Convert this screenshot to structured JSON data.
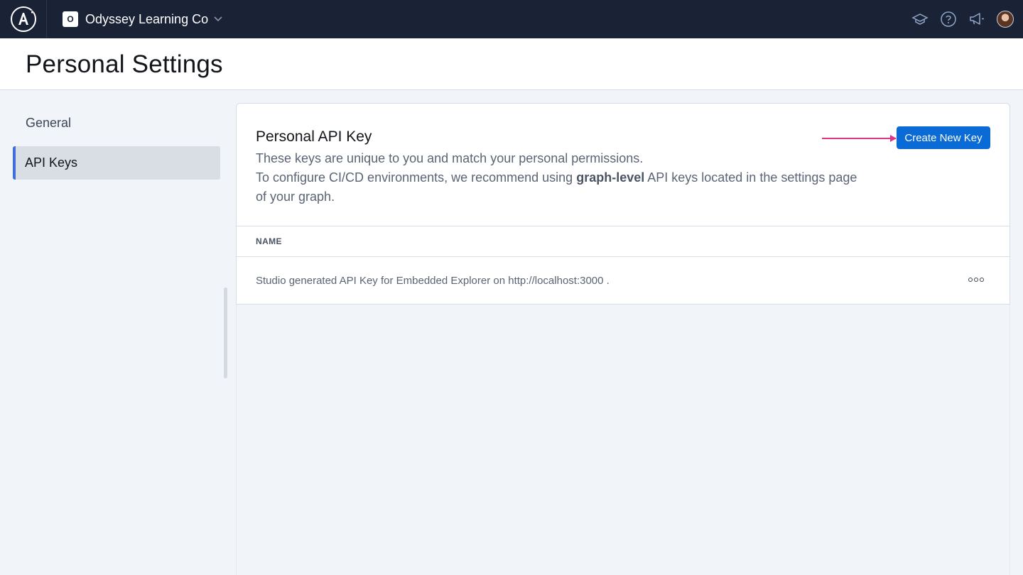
{
  "topbar": {
    "org_initial": "O",
    "org_name": "Odyssey Learning Co",
    "icons": [
      "apollo-logo-icon",
      "chevron-down-icon",
      "learn-hat-icon",
      "help-icon",
      "announcement-icon",
      "avatar"
    ]
  },
  "header": {
    "title": "Personal Settings"
  },
  "sidebar": {
    "items": [
      {
        "label": "General",
        "active": false
      },
      {
        "label": "API Keys",
        "active": true
      }
    ]
  },
  "card": {
    "title": "Personal API Key",
    "desc_line1": "These keys are unique to you and match your personal permissions.",
    "desc_line2_pre": "To configure CI/CD environments, we recommend using ",
    "desc_line2_bold": "graph-level",
    "desc_line2_post": " API keys located in the settings page of your graph.",
    "create_button": "Create New Key",
    "accent_color": "#0a6ad6",
    "arrow_color": "#e0338a"
  },
  "table": {
    "column_name": "NAME",
    "rows": [
      {
        "name": "Studio generated API Key for Embedded Explorer on http://localhost:3000 ."
      }
    ]
  }
}
